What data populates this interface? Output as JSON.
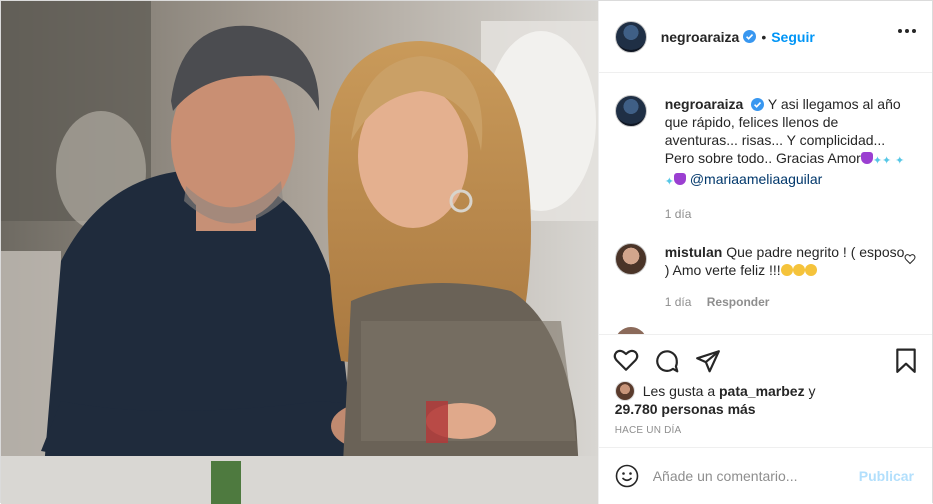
{
  "post": {
    "author": {
      "username": "negroaraiza",
      "verified": true,
      "follow_label": "Seguir",
      "separator": "•"
    },
    "caption": {
      "username": "negroaraiza",
      "text": "Y asi llegamos al año que rápido, felices llenos de aventuras... risas... Y complicidad... Pero sobre todo.. Gracias Amor",
      "mention": "@mariaameliaaguilar",
      "time": "1 día"
    },
    "comments": [
      {
        "username": "mistulan",
        "text": "Que padre negrito ! ( esposo ) Amo verte feliz !!!",
        "time": "1 día",
        "reply_label": "Responder"
      }
    ],
    "likes": {
      "prefix": "Les gusta a",
      "liker": "pata_marbez",
      "conj": "y",
      "count_text": "29.780 personas más"
    },
    "timestamp": "Hace un día",
    "add_comment": {
      "placeholder": "Añade un comentario...",
      "publish_label": "Publicar"
    }
  },
  "colors": {
    "link_blue": "#0095f6",
    "publish_disabled": "#b2dffc",
    "muted": "#8e8e8e",
    "mention": "#00376b",
    "verified": "#3897f0"
  },
  "icons": {
    "like": "heart-icon",
    "comment": "comment-bubble-icon",
    "share": "paper-plane-icon",
    "save": "bookmark-icon",
    "more": "ellipsis-icon",
    "emoji": "smiley-icon"
  }
}
